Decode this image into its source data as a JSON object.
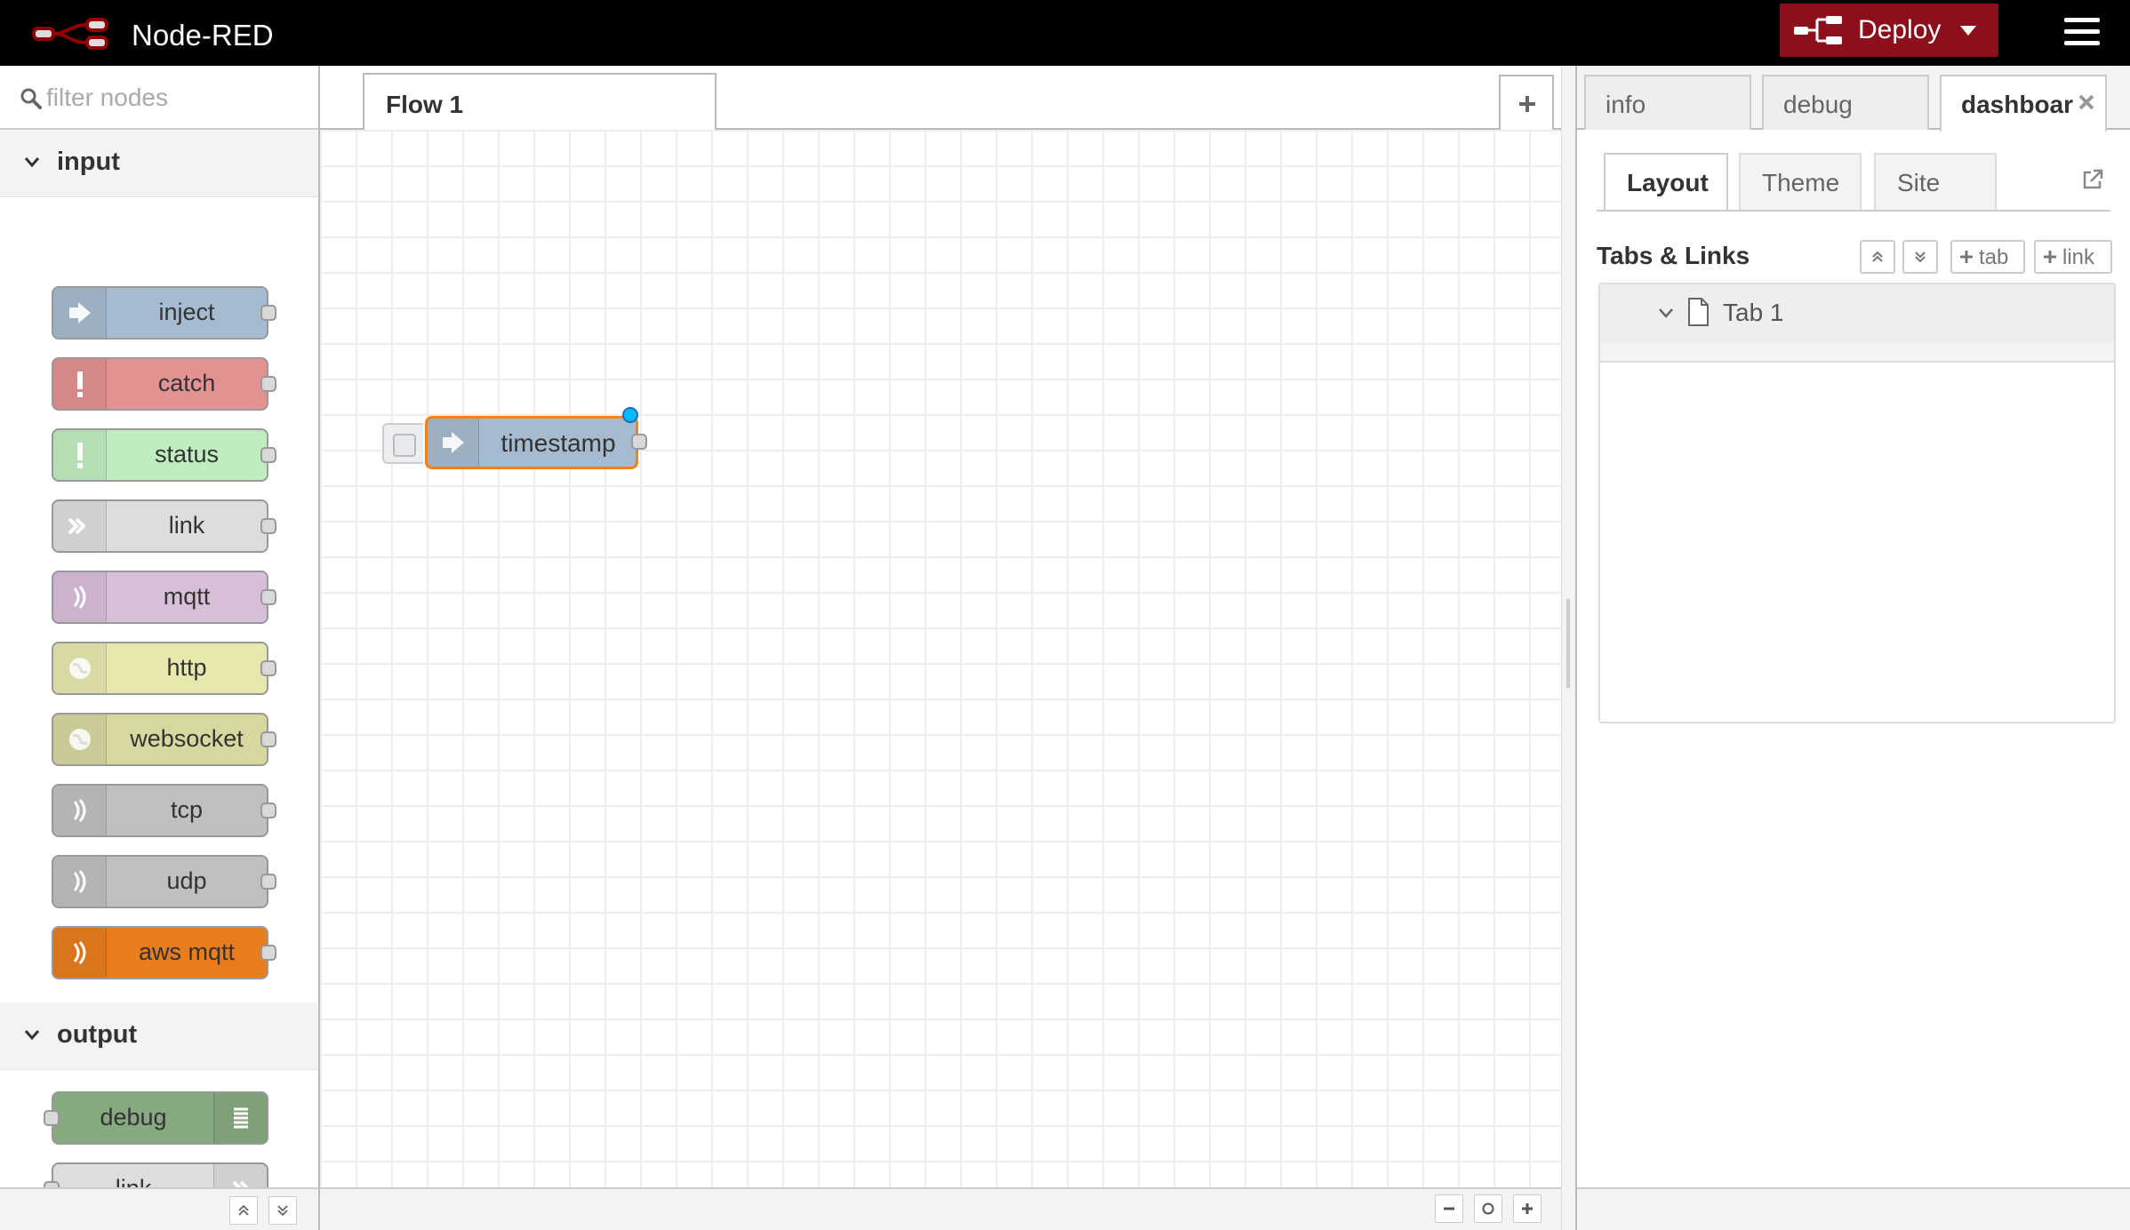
{
  "header": {
    "title": "Node-RED",
    "deploy_label": "Deploy",
    "menu_icon": "hamburger-menu-icon"
  },
  "palette": {
    "search_placeholder": "filter nodes",
    "categories": [
      {
        "label": "input",
        "nodes": [
          {
            "label": "inject",
            "color": "#a6bbcf",
            "icon": "arrow-in-icon"
          },
          {
            "label": "catch",
            "color": "#e49191",
            "icon": "alert-icon"
          },
          {
            "label": "status",
            "color": "#c0edc0",
            "icon": "alert-icon"
          },
          {
            "label": "link",
            "color": "#dddddd",
            "icon": "link-in-icon"
          },
          {
            "label": "mqtt",
            "color": "#d8bfd8",
            "icon": "bridge-icon"
          },
          {
            "label": "http",
            "color": "#e7e7ae",
            "icon": "globe-icon"
          },
          {
            "label": "websocket",
            "color": "#d7d7a0",
            "icon": "globe-icon"
          },
          {
            "label": "tcp",
            "color": "#c0c0c0",
            "icon": "bridge-icon"
          },
          {
            "label": "udp",
            "color": "#c0c0c0",
            "icon": "bridge-icon"
          },
          {
            "label": "aws mqtt",
            "color": "#e87d1e",
            "icon": "bridge-icon"
          }
        ]
      },
      {
        "label": "output",
        "nodes": [
          {
            "label": "debug",
            "color": "#87a980",
            "icon": "debug-list-icon"
          },
          {
            "label": "link",
            "color": "#dddddd",
            "icon": "link-out-icon"
          },
          {
            "label": "",
            "color": "#d8bfd8",
            "icon": "bridge-icon"
          }
        ]
      }
    ]
  },
  "workspace": {
    "tabs": [
      {
        "label": "Flow 1"
      }
    ],
    "nodes": [
      {
        "label": "timestamp",
        "color": "#a6bbcf",
        "icon": "arrow-in-icon",
        "changed": true,
        "selected": true
      }
    ]
  },
  "sidebar": {
    "tabs": [
      {
        "label": "info",
        "active": false
      },
      {
        "label": "debug",
        "active": false
      },
      {
        "label": "dashboar",
        "active": true
      }
    ],
    "dashboard": {
      "subtabs": [
        {
          "label": "Layout",
          "active": true
        },
        {
          "label": "Theme",
          "active": false
        },
        {
          "label": "Site",
          "active": false
        }
      ],
      "tabs_links_title": "Tabs & Links",
      "add_tab_label": "tab",
      "add_link_label": "link",
      "items": [
        {
          "label": "Tab 1",
          "expanded": true
        }
      ]
    }
  }
}
